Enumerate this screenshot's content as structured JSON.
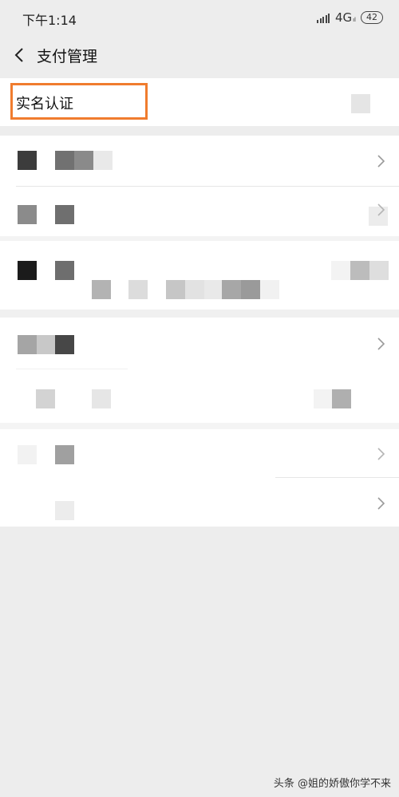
{
  "status_bar": {
    "time": "下午1:14",
    "network": "4G",
    "network_sub": "ıl",
    "battery": "42"
  },
  "header": {
    "title": "支付管理"
  },
  "rows": {
    "real_name": {
      "label": "实名认证"
    }
  },
  "colors": {
    "highlight": "#f07c2e",
    "background": "#ededed",
    "card": "#ffffff"
  },
  "watermark": "头条 @姐的娇傲你学不来"
}
